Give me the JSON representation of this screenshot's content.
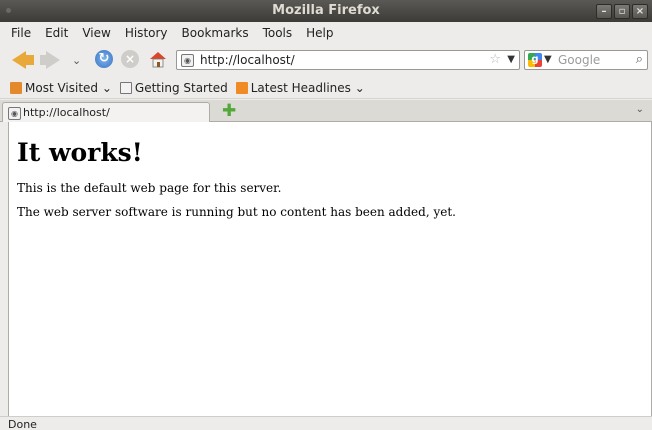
{
  "window": {
    "title": "Mozilla Firefox"
  },
  "window_controls": [
    "–",
    "▫",
    "×"
  ],
  "menubar": [
    {
      "label": "File"
    },
    {
      "label": "Edit"
    },
    {
      "label": "View"
    },
    {
      "label": "History"
    },
    {
      "label": "Bookmarks"
    },
    {
      "label": "Tools"
    },
    {
      "label": "Help"
    }
  ],
  "navigation": {
    "url": "http://localhost/",
    "search_placeholder": "Google"
  },
  "bookmarks": [
    {
      "label": "Most Visited",
      "icon": "folder-icon",
      "has_dropdown": true
    },
    {
      "label": "Getting Started",
      "icon": "page-icon",
      "has_dropdown": false
    },
    {
      "label": "Latest Headlines",
      "icon": "rss-icon",
      "has_dropdown": true
    }
  ],
  "tabs": [
    {
      "label": "http://localhost/"
    }
  ],
  "page": {
    "heading": "It works!",
    "paragraphs": [
      "This is the default web page for this server.",
      "The web server software is running but no content has been added, yet."
    ]
  },
  "status": {
    "text": "Done"
  },
  "colors": {
    "titlebar": "#3c3b37",
    "chrome": "#edeceb",
    "back_arrow": "#e9a93a",
    "reload": "#3873c4"
  }
}
